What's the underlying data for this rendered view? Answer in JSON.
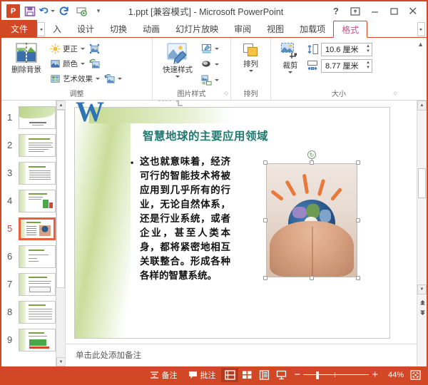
{
  "window": {
    "title": "1.ppt [兼容模式] - Microsoft PowerPoint",
    "accent_color": "#D24726",
    "quick_access": [
      {
        "name": "powerpoint-logo",
        "label": "P"
      },
      {
        "name": "save-icon",
        "label": "保存"
      },
      {
        "name": "undo-icon",
        "label": "撤消"
      },
      {
        "name": "redo-icon",
        "label": "恢复"
      },
      {
        "name": "slideshow-icon",
        "label": "从头开始"
      },
      {
        "name": "customize-qat-icon",
        "label": "自定义快速访问工具栏"
      }
    ],
    "caption_buttons": [
      {
        "name": "help-button",
        "glyph": "?"
      },
      {
        "name": "ribbon-display-options-button",
        "glyph": "⊼"
      },
      {
        "name": "minimize-button",
        "glyph": "—"
      },
      {
        "name": "maximize-button",
        "glyph": "❐"
      },
      {
        "name": "close-button",
        "glyph": "✕"
      }
    ]
  },
  "tabs": {
    "file_label": "文件",
    "items": [
      {
        "label": "入",
        "active": false
      },
      {
        "label": "设计",
        "active": false
      },
      {
        "label": "切换",
        "active": false
      },
      {
        "label": "动画",
        "active": false
      },
      {
        "label": "幻灯片放映",
        "active": false
      },
      {
        "label": "审阅",
        "active": false
      },
      {
        "label": "视图",
        "active": false
      },
      {
        "label": "加载项",
        "active": false
      },
      {
        "label": "格式",
        "active": true
      }
    ],
    "scroll_left": "◂",
    "scroll_right": "▸"
  },
  "ribbon": {
    "collapse_glyph": "▲",
    "groups": [
      {
        "name": "adjust",
        "label": "调整",
        "remove_background": "删除背景",
        "corrections": "更正",
        "color": "颜色",
        "artistic_effects": "艺术效果",
        "compress_pictures": "压缩图片",
        "change_picture": "更改图片",
        "reset_picture": "重设图片"
      },
      {
        "name": "picture-styles",
        "label": "图片样式",
        "quick_styles": "快速样式",
        "picture_border": "图片边框",
        "picture_effects": "图片效果",
        "picture_layout": "图片版式",
        "launcher": "⬦"
      },
      {
        "name": "arrange",
        "label": "排列",
        "arrange_button": "排列"
      },
      {
        "name": "size",
        "label": "大小",
        "crop_button": "裁剪",
        "height_value": "10.6 厘米",
        "width_value": "8.77 厘米",
        "launcher": "⬦"
      }
    ]
  },
  "thumbnails": {
    "selected": 5,
    "slides": [
      {
        "num": "1",
        "kind": "title"
      },
      {
        "num": "2",
        "kind": "text"
      },
      {
        "num": "3",
        "kind": "text"
      },
      {
        "num": "4",
        "kind": "chart"
      },
      {
        "num": "5",
        "kind": "picture"
      },
      {
        "num": "6",
        "kind": "text"
      },
      {
        "num": "7",
        "kind": "text"
      },
      {
        "num": "8",
        "kind": "text"
      },
      {
        "num": "9",
        "kind": "chart"
      }
    ],
    "scroll_up": "▲",
    "scroll_down": "▼"
  },
  "slide": {
    "watermark": "W",
    "title": "智慧地球的主要应用领域",
    "title_color": "#1f7a6f",
    "bullet_glyph": "•",
    "body": "这也就意味着，经济可行的智能技术将被应用到几乎所有的行业，无论自然体系，还是行业系统，或者企业，甚至人类本身，都将紧密地相互关联整合。形成各种各样的智慧系统。",
    "picture": {
      "name": "earth-in-hands-picture",
      "alt": "双手捧着地球，上方有橙色射线",
      "selected": true,
      "rotate_glyph": "↻"
    }
  },
  "editor_scroll": {
    "up": "▲",
    "down": "▼",
    "prev_slide": "▲",
    "next_slide": "▼"
  },
  "notes": {
    "placeholder": "单击此处添加备注"
  },
  "statusbar": {
    "notes_label": "备注",
    "comments_label": "批注",
    "views": [
      {
        "name": "normal-view-button",
        "label": "普通视图",
        "active": true
      },
      {
        "name": "slide-sorter-view-button",
        "label": "幻灯片浏览",
        "active": false
      },
      {
        "name": "reading-view-button",
        "label": "阅读视图",
        "active": false
      },
      {
        "name": "slideshow-view-button",
        "label": "幻灯片放映",
        "active": false
      }
    ],
    "zoom_out": "−",
    "zoom_in": "+",
    "zoom_level": "44%",
    "fit_slide_label": "使幻灯片适应当前窗口"
  }
}
